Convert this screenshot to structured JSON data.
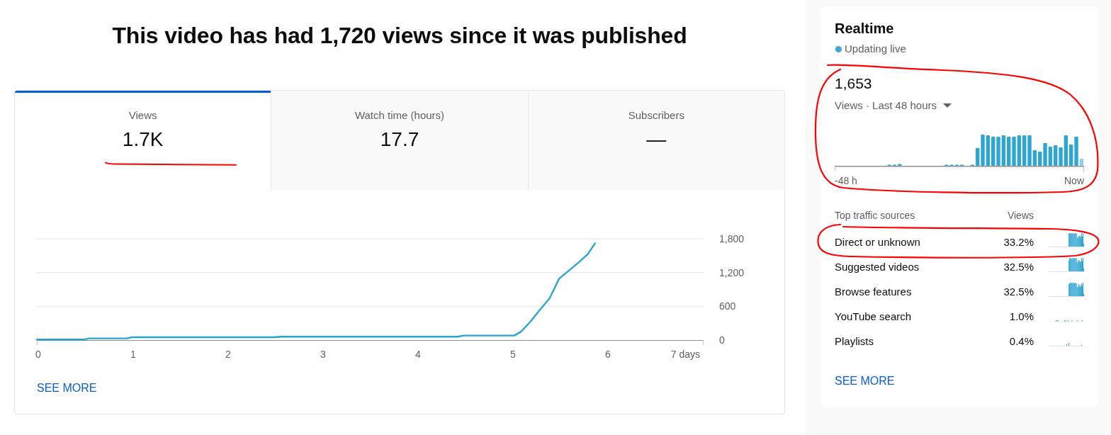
{
  "headline": "This video has had 1,720 views since it was published",
  "metric_tabs": [
    {
      "label": "Views",
      "value": "1.7K",
      "selected": true,
      "underlined": true
    },
    {
      "label": "Watch time (hours)",
      "value": "17.7",
      "selected": false,
      "underlined": false
    },
    {
      "label": "Subscribers",
      "value": "—",
      "selected": false,
      "underlined": false
    }
  ],
  "views_chart": {
    "chart_data": {
      "type": "line",
      "x": [
        0,
        0.5,
        0.55,
        0.95,
        1.0,
        2.5,
        2.57,
        4.43,
        4.5,
        5.03,
        5.1,
        5.2,
        5.3,
        5.4,
        5.5,
        5.6,
        5.7,
        5.8,
        5.88
      ],
      "series": [
        {
          "color": "#2ba3d0",
          "values": [
            10,
            10,
            30,
            30,
            50,
            50,
            60,
            60,
            80,
            80,
            150,
            330,
            540,
            740,
            1090,
            1230,
            1370,
            1520,
            1720
          ]
        }
      ],
      "xlim": [
        0,
        7
      ],
      "ylim": [
        0,
        1800
      ],
      "xticks": [
        0,
        1,
        2,
        3,
        4,
        5,
        6,
        {
          "value": 7,
          "label": "7 days"
        }
      ],
      "yticks": [
        {
          "value": 0,
          "label": "0"
        },
        {
          "value": 600,
          "label": "600"
        },
        {
          "value": 1200,
          "label": "1,200"
        },
        {
          "value": 1800,
          "label": "1,800"
        }
      ]
    }
  },
  "see_more": "SEE MORE",
  "realtime": {
    "title": "Realtime",
    "status": "Updating live",
    "total": "1,653",
    "range": "Views · Last 48 hours",
    "circled": true,
    "axis_start": "-48 h",
    "axis_end": "Now",
    "traffic": {
      "columns": [
        "Top traffic sources",
        "Views"
      ],
      "rows": [
        {
          "source": "Direct or unknown",
          "share": "33.2%",
          "circled": true
        },
        {
          "source": "Suggested videos",
          "share": "32.5%",
          "circled": false
        },
        {
          "source": "Browse features",
          "share": "32.5%",
          "circled": false
        },
        {
          "source": "YouTube search",
          "share": "1.0%",
          "circled": false
        },
        {
          "source": "Playlists",
          "share": "0.4%",
          "circled": false
        }
      ]
    },
    "see_more": "SEE MORE"
  }
}
